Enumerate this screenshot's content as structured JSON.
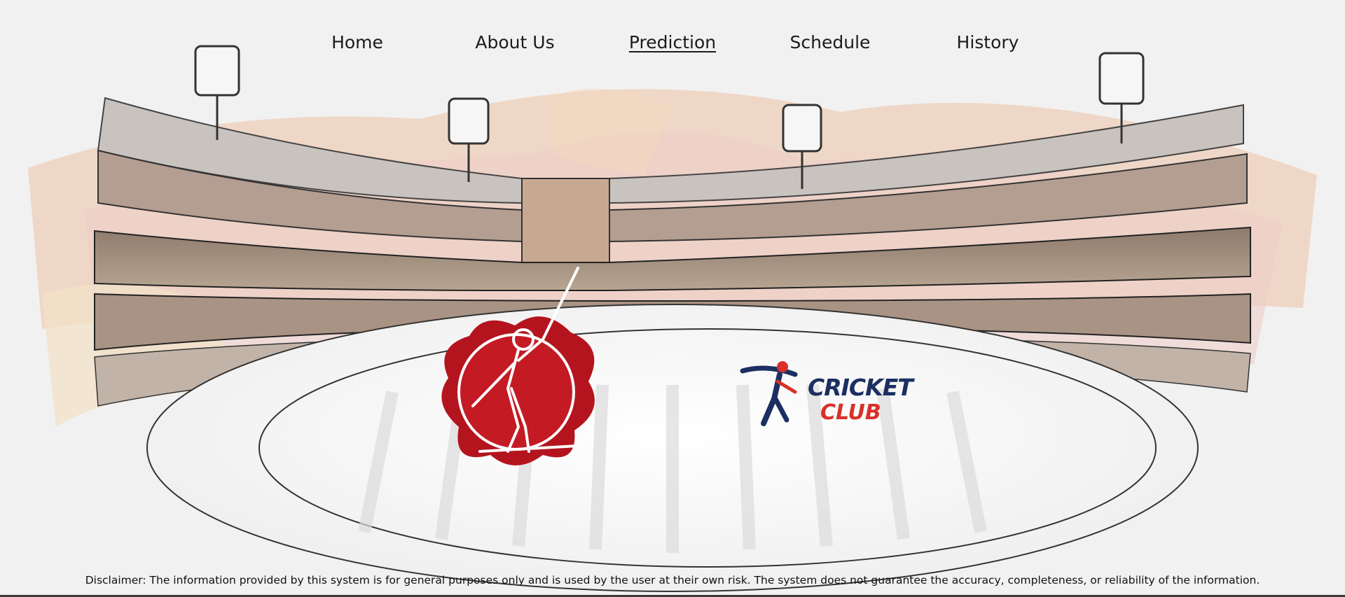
{
  "nav": {
    "items": [
      {
        "label": "Home"
      },
      {
        "label": "About Us"
      },
      {
        "label": "Prediction",
        "active": true
      },
      {
        "label": "Schedule"
      },
      {
        "label": "History"
      }
    ]
  },
  "logos": {
    "club_logo_line1": "CRICKET",
    "club_logo_line2": "CLUB"
  },
  "footer": {
    "disclaimer": "Disclaimer: The information provided by this system is for general purposes only and is used by the user at their own risk. The system does not guarantee the accuracy, completeness, or reliability of the information."
  },
  "colors": {
    "crimson": "#b4141e",
    "navy": "#1c2f62",
    "red_text": "#d8312a",
    "background": "#f1f1f1"
  }
}
